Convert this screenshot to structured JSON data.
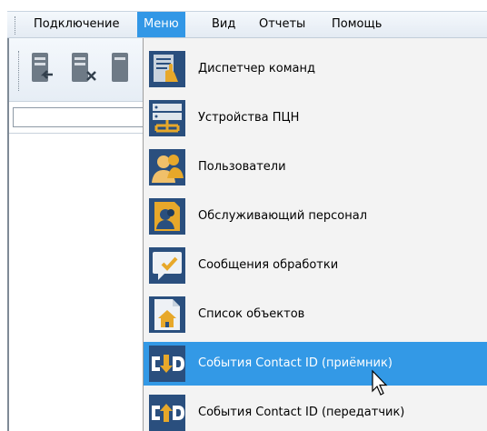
{
  "menubar": {
    "items": [
      {
        "label": "Подключение",
        "active": false
      },
      {
        "label": "Меню",
        "active": true
      },
      {
        "label": "Вид",
        "active": false
      },
      {
        "label": "Отчеты",
        "active": false
      },
      {
        "label": "Помощь",
        "active": false
      }
    ]
  },
  "menu": {
    "items": [
      {
        "label": "Диспетчер команд",
        "icon": "command-dispatcher-icon",
        "highlighted": false
      },
      {
        "label": "Устройства ПЦН",
        "icon": "server-devices-icon",
        "highlighted": false
      },
      {
        "label": "Пользователи",
        "icon": "users-icon",
        "highlighted": false
      },
      {
        "label": "Обслуживающий персонал",
        "icon": "service-staff-icon",
        "highlighted": false
      },
      {
        "label": "Сообщения обработки",
        "icon": "processing-messages-icon",
        "highlighted": false
      },
      {
        "label": "Список объектов",
        "icon": "object-list-icon",
        "highlighted": false
      },
      {
        "label": "События Contact ID (приёмник)",
        "icon": "contact-id-receiver-icon",
        "highlighted": true
      },
      {
        "label": "События Contact ID (передатчик)",
        "icon": "contact-id-transmitter-icon",
        "highlighted": false
      }
    ]
  },
  "colors": {
    "highlight": "#3399e6",
    "icon_gold": "#e7a82a",
    "icon_navy": "#2a4f7e"
  }
}
